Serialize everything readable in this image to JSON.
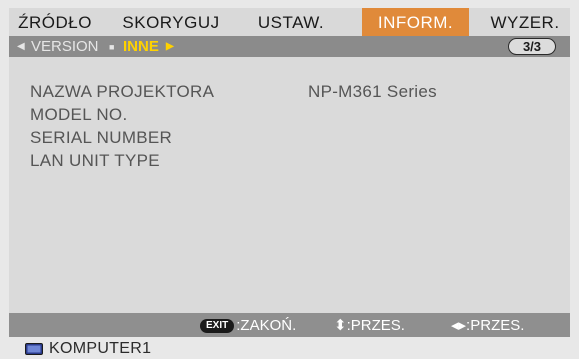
{
  "tabs": [
    {
      "label": "ŹRÓDŁO",
      "active": false
    },
    {
      "label": "SKORYGUJ",
      "active": false
    },
    {
      "label": "USTAW.",
      "active": false
    },
    {
      "label": "INFORM.",
      "active": true
    },
    {
      "label": "WYZER.",
      "active": false
    }
  ],
  "subtabs": [
    {
      "label": "VERSION",
      "active": false
    },
    {
      "label": "INNE",
      "active": true
    }
  ],
  "page_indicator": "3/3",
  "info_rows": [
    {
      "label": "NAZWA PROJEKTORA",
      "value": "NP-M361 Series"
    },
    {
      "label": "MODEL NO.",
      "value": ""
    },
    {
      "label": "SERIAL NUMBER",
      "value": ""
    },
    {
      "label": "LAN UNIT TYPE",
      "value": ""
    }
  ],
  "help": {
    "exit_key": "EXIT",
    "exit_label": ":ZAKOŃ.",
    "updown_label": "⬍:PRZES.",
    "leftright_label": "◂▸:PRZES."
  },
  "source": {
    "icon": "monitor-icon",
    "label": "KOMPUTER1"
  },
  "colors": {
    "active_tab": "#e08a3a",
    "active_subtab": "#ffd200"
  }
}
